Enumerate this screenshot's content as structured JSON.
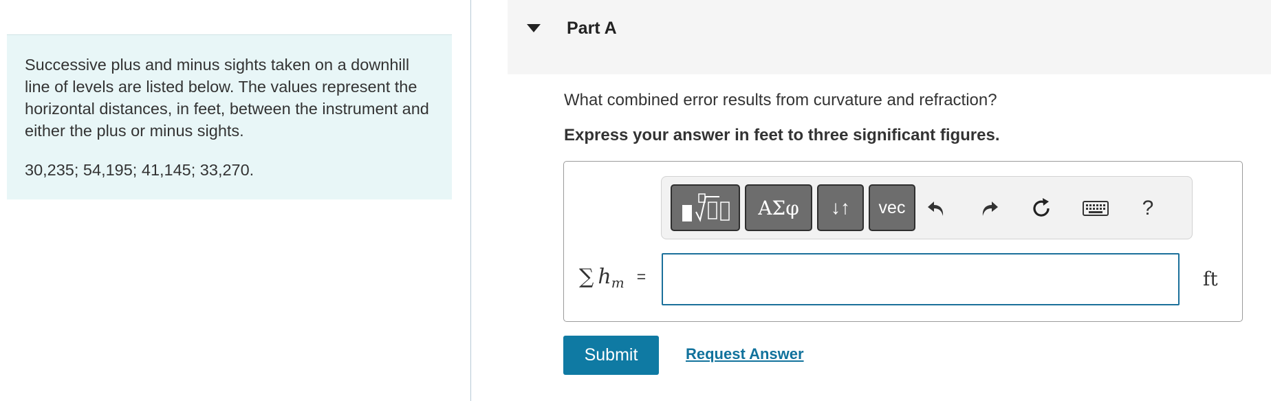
{
  "problem": {
    "text": "Successive plus and minus sights taken on a downhill line of levels are listed below. The values represent the horizontal distances, in feet, between the instrument and either the plus or minus sights.",
    "values": "30,235; 54,195; 41,145; 33,270."
  },
  "part": {
    "title": "Part A",
    "question": "What combined error results from curvature and refraction?",
    "instruction": "Express your answer in feet to three significant figures."
  },
  "toolbar": {
    "greek_label": "ΑΣφ",
    "arrows_label": "↓↑",
    "vec_label": "vec",
    "help_label": "?"
  },
  "answer": {
    "label_sigma": "∑",
    "label_h": "h",
    "label_sub": "m",
    "label_eq": "=",
    "value": "",
    "unit": "ft"
  },
  "buttons": {
    "submit": "Submit",
    "request": "Request Answer"
  },
  "colors": {
    "panel_bg": "#e8f6f7",
    "accent": "#0f7aa3",
    "link": "#11729c",
    "input_border": "#1a6f9a"
  },
  "icons": [
    "templates-icon",
    "undo-icon",
    "redo-icon",
    "reset-icon",
    "keyboard-icon",
    "caret-down-icon"
  ]
}
